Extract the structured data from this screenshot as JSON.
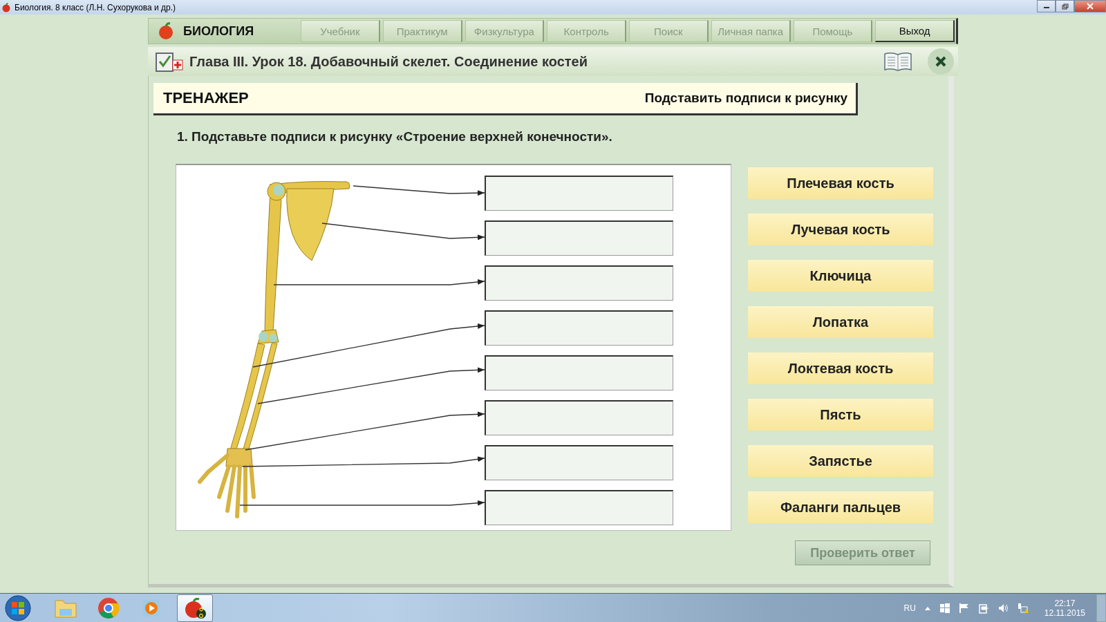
{
  "window": {
    "title": "Биология. 8 класс (Л.Н. Сухорукова и др.)"
  },
  "app": {
    "brand": "БИОЛОГИЯ"
  },
  "nav": [
    {
      "label": "Учебник",
      "disabled": true
    },
    {
      "label": "Практикум",
      "disabled": true
    },
    {
      "label": "Физкультура",
      "disabled": true
    },
    {
      "label": "Контроль",
      "disabled": true
    },
    {
      "label": "Поиск",
      "disabled": true
    },
    {
      "label": "Личная папка",
      "disabled": true
    },
    {
      "label": "Помощь",
      "disabled": true
    },
    {
      "label": "Выход",
      "disabled": false
    }
  ],
  "lesson": {
    "title": "Глава III. Урок 18. Добавочный скелет. Соединение костей"
  },
  "trainer": {
    "title": "ТРЕНАЖЕР",
    "task": "Подставить подписи к рисунку"
  },
  "question": "1. Подставьте подписи к рисунку «Строение верхней конечности».",
  "slots": [
    {
      "kind": "empty"
    },
    {
      "kind": "empty"
    },
    {
      "kind": "empty"
    },
    {
      "kind": "empty"
    },
    {
      "kind": "empty"
    },
    {
      "kind": "empty"
    },
    {
      "kind": "empty"
    },
    {
      "kind": "empty"
    }
  ],
  "answers": [
    "Плечевая кость",
    "Лучевая кость",
    "Ключица",
    "Лопатка",
    "Локтевая кость",
    "Пясть",
    "Запястье",
    "Фаланги пальцев"
  ],
  "check_button": {
    "label": "Проверить ответ",
    "disabled": true
  },
  "taskbar": {
    "apps": [
      {
        "kind": "explorer",
        "selected": false
      },
      {
        "kind": "chrome",
        "selected": false
      },
      {
        "kind": "media",
        "selected": false
      },
      {
        "kind": "biology",
        "selected": true
      }
    ],
    "language": "RU",
    "time": "22:17",
    "date": "12.11.2015"
  }
}
